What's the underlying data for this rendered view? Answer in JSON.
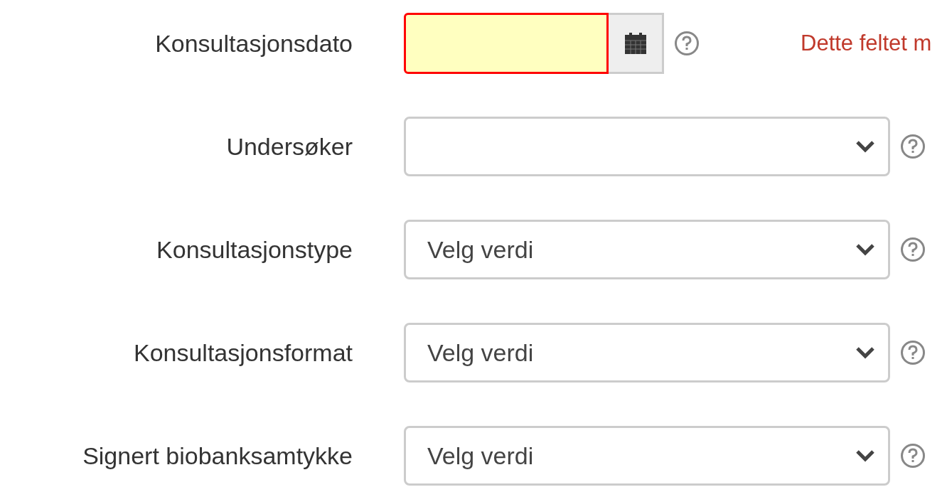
{
  "fields": [
    {
      "kind": "date",
      "label": "Konsultasjonsdato",
      "invalid": true,
      "error": "Dette feltet m"
    },
    {
      "kind": "select",
      "label": "Undersøker"
    },
    {
      "kind": "select",
      "label": "Konsultasjonstype",
      "value": "Velg verdi"
    },
    {
      "kind": "select",
      "label": "Konsultasjonsformat",
      "value": "Velg verdi"
    },
    {
      "kind": "select",
      "label": "Signert biobanksamtykke",
      "value": "Velg verdi"
    }
  ]
}
